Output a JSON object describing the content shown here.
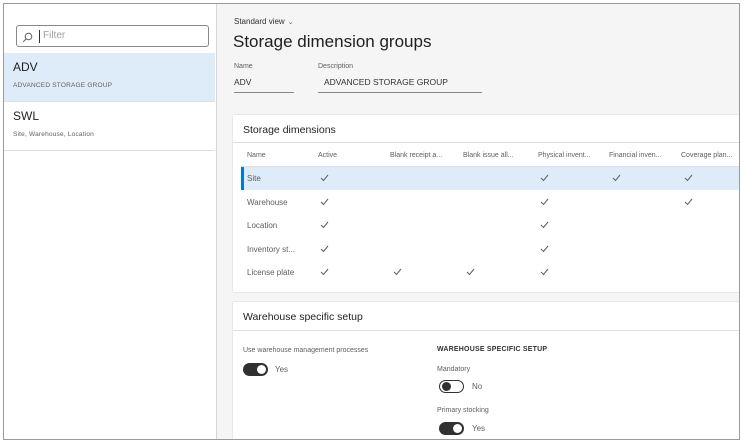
{
  "list_pane": {
    "filter_placeholder": "Filter",
    "items": [
      {
        "name": "ADV",
        "description": "ADVANCED STORAGE GROUP",
        "selected": true
      },
      {
        "name": "SWL",
        "description": "Site, Warehouse, Location",
        "selected": false
      }
    ]
  },
  "header": {
    "view_name": "Standard view",
    "page_title": "Storage dimension groups"
  },
  "fields": {
    "name_label": "Name",
    "name_value": "ADV",
    "description_label": "Description",
    "description_value": "ADVANCED STORAGE GROUP"
  },
  "storage_dimensions": {
    "title": "Storage dimensions",
    "columns": [
      "Name",
      "Active",
      "Blank receipt a...",
      "Blank issue all...",
      "Physical invent...",
      "Financial inven...",
      "Coverage plan..."
    ],
    "rows": [
      {
        "name": "Site",
        "checks": [
          true,
          false,
          false,
          true,
          true,
          true
        ],
        "selected": true
      },
      {
        "name": "Warehouse",
        "checks": [
          true,
          false,
          false,
          true,
          false,
          true
        ],
        "selected": false
      },
      {
        "name": "Location",
        "checks": [
          true,
          false,
          false,
          true,
          false,
          false
        ],
        "selected": false
      },
      {
        "name": "Inventory st...",
        "checks": [
          true,
          false,
          false,
          true,
          false,
          false
        ],
        "selected": false
      },
      {
        "name": "License plate",
        "checks": [
          true,
          true,
          true,
          true,
          false,
          false
        ],
        "selected": false
      }
    ]
  },
  "warehouse_setup": {
    "title": "Warehouse specific setup",
    "use_wmp_label": "Use warehouse management processes",
    "use_wmp_value": "Yes",
    "use_wmp_on": true,
    "section_label": "WAREHOUSE SPECIFIC SETUP",
    "mandatory_label": "Mandatory",
    "mandatory_value": "No",
    "mandatory_on": false,
    "primary_stocking_label": "Primary stocking",
    "primary_stocking_value": "Yes",
    "primary_stocking_on": true
  },
  "colors": {
    "accent": "#0078d4",
    "selected_bg": "#deecf9",
    "toggle_on": "#323130"
  }
}
